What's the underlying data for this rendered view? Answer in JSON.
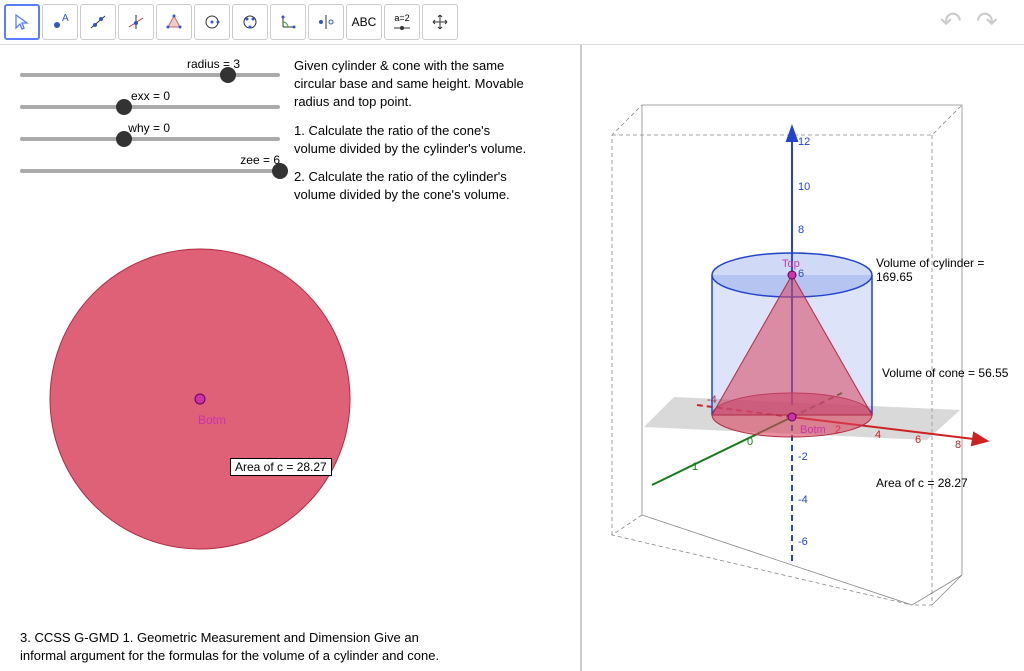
{
  "toolbar": {
    "tools": [
      "pointer",
      "point",
      "line",
      "perpendicular",
      "polygon",
      "circle",
      "ellipse",
      "angle",
      "reflect",
      "text",
      "slider",
      "move"
    ],
    "text_tool_label": "ABC",
    "slider_tool_label": "a=2"
  },
  "sliders": {
    "radius": {
      "label": "radius = 3",
      "pos": 80
    },
    "exx": {
      "label": "exx = 0",
      "pos": 40
    },
    "why": {
      "label": "why = 0",
      "pos": 40
    },
    "zee": {
      "label": "zee = 6",
      "pos": 100
    }
  },
  "instructions": {
    "intro": "Given cylinder & cone with the same circular base and same height. Movable radius and top point.",
    "q1": "1. Calculate the ratio of the cone's volume divided by the cylinder's volume.",
    "q2": "2. Calculate the ratio of the cylinder's volume divided by the cone's volume."
  },
  "circle2d": {
    "point_label": "Botm",
    "area_label": "Area of c = 28.27"
  },
  "bottom_note": "3.  CCSS G-GMD 1.  Geometric Measurement and Dimension Give an informal argument for the formulas for the volume of a cylinder and cone.",
  "view3d": {
    "vol_cylinder": "Volume of cylinder = 169.65",
    "vol_cone": "Volume of cone = 56.55",
    "area_c": "Area of c = 28.27",
    "top_label": "Top",
    "botm_label": "Botm",
    "z_ticks": [
      "12",
      "10",
      "8",
      "6",
      "-2",
      "-4",
      "-6"
    ],
    "x_ticks": [
      "-4",
      "2",
      "4",
      "6",
      "8"
    ],
    "y_ticks": [
      "0",
      "1"
    ]
  },
  "chart_data": {
    "type": "table",
    "parameters": {
      "radius": 3,
      "exx": 0,
      "why": 0,
      "zee": 6
    },
    "computed": {
      "area_of_c": 28.27,
      "volume_of_cylinder": 169.65,
      "volume_of_cone": 56.55
    },
    "axes": {
      "z_range": [
        -6,
        12
      ],
      "x_range": [
        -4,
        8
      ]
    }
  }
}
